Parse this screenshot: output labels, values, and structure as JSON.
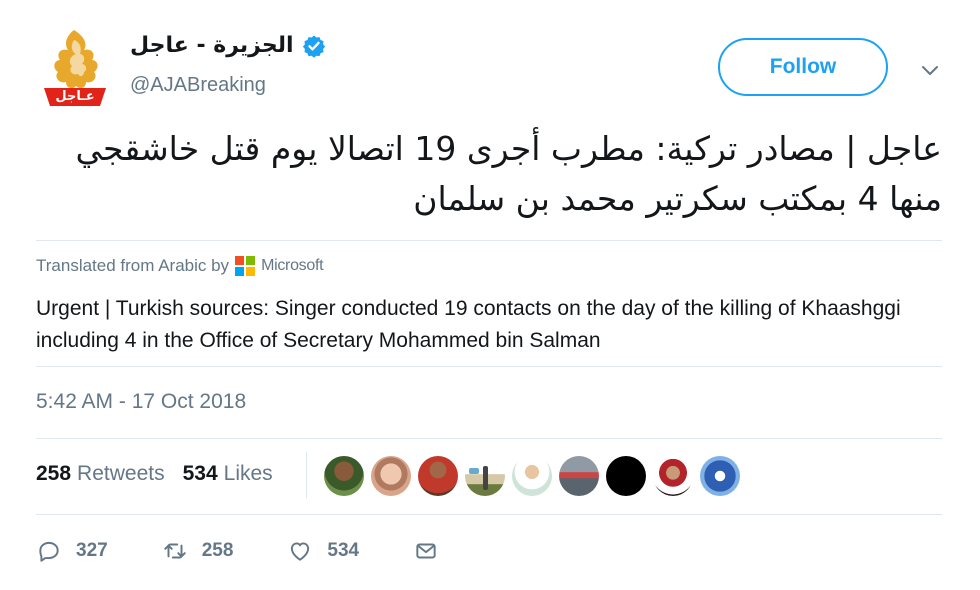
{
  "author": {
    "display_name": "الجزيرة - عاجل",
    "handle": "@AJABreaking",
    "logo_label": "عـاجل",
    "logo_icon": "aljazeera-logo",
    "verified_icon": "verified-badge-icon"
  },
  "header": {
    "follow_label": "Follow",
    "menu_icon": "chevron-down-icon"
  },
  "tweet": {
    "text": "عاجل | مصادر تركية: مطرب أجرى 19 اتصالا يوم قتل خاشقجي منها 4 بمكتب سكرتير محمد بن سلمان",
    "translated_from": "Translated from Arabic by",
    "translator": "Microsoft",
    "translation": "Urgent | Turkish sources: Singer conducted 19 contacts on the day of the killing of Khaashggi including 4 in the Office of Secretary Mohammed bin Salman",
    "timestamp": "5:42 AM - 17 Oct 2018"
  },
  "stats": {
    "retweets_count": "258",
    "retweets_label": "Retweets",
    "likes_count": "534",
    "likes_label": "Likes"
  },
  "actions": {
    "reply_count": "327",
    "retweet_count": "258",
    "like_count": "534"
  },
  "colors": {
    "accent": "#1da1f2",
    "muted": "#657786",
    "text": "#14171a",
    "divider": "#e1e8ed",
    "logo_gold": "#e6a11a",
    "logo_red": "#e2231a"
  }
}
